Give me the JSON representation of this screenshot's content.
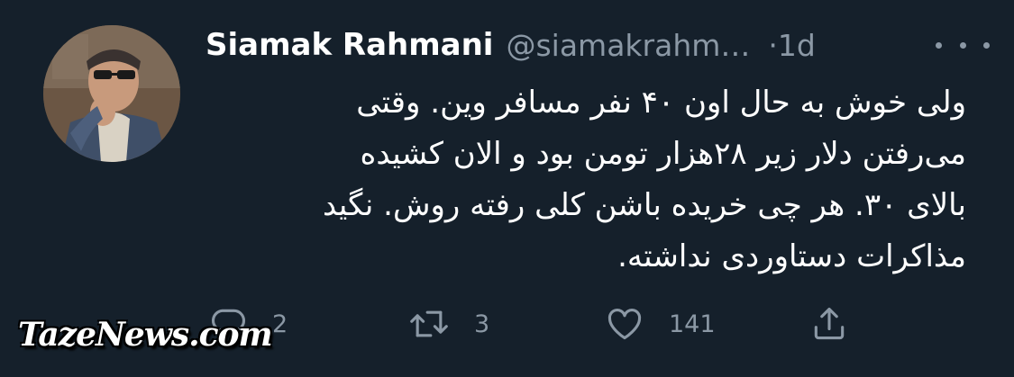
{
  "tweet": {
    "display_name": "Siamak Rahmani",
    "handle": "@siamakrahm…",
    "time": "·1d",
    "body_lines": [
      "ولی خوش به حال اون ۴۰ نفر مسافر وین. وقتی",
      "می‌رفتن دلار زیر ۲۸هزار تومن بود و الان کشیده",
      "بالای ۳۰. هر چی خریده باشن کلی رفته روش. نگید",
      "مذاکرات دستاوردی نداشته."
    ]
  },
  "actions": {
    "reply": {
      "icon": "reply-icon",
      "count": "2"
    },
    "retweet": {
      "icon": "retweet-icon",
      "count": "3"
    },
    "like": {
      "icon": "heart-icon",
      "count": "141"
    },
    "share": {
      "icon": "share-icon"
    }
  },
  "watermark": "TazeNews.com",
  "colors": {
    "background": "#15202b",
    "text": "#ffffff",
    "muted": "#8b98a5"
  }
}
